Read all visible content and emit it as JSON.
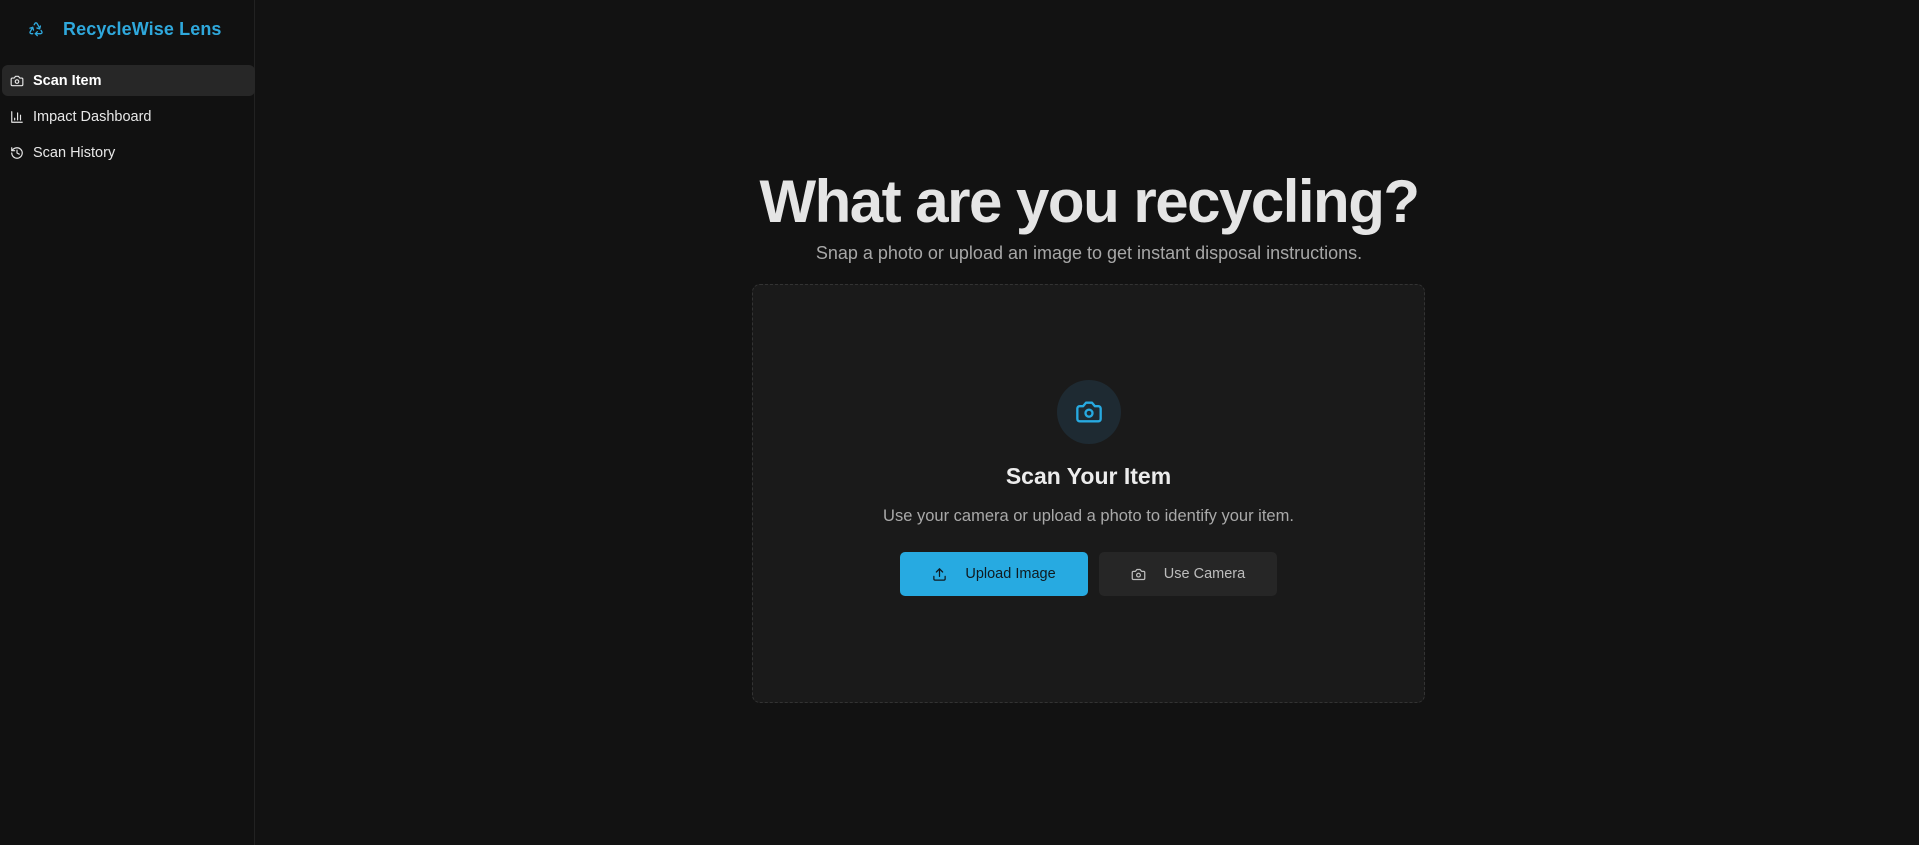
{
  "app": {
    "name": "RecycleWise Lens"
  },
  "sidebar": {
    "items": [
      {
        "label": "Scan Item",
        "icon": "camera-icon",
        "active": true
      },
      {
        "label": "Impact Dashboard",
        "icon": "bar-chart-icon",
        "active": false
      },
      {
        "label": "Scan History",
        "icon": "history-icon",
        "active": false
      }
    ]
  },
  "main": {
    "title": "What are you recycling?",
    "subtitle": "Snap a photo or upload an image to get instant disposal instructions.",
    "card": {
      "icon": "camera-icon",
      "title": "Scan Your Item",
      "text": "Use your camera or upload a photo to identify your item.",
      "upload_label": "Upload Image",
      "upload_icon": "upload-icon",
      "camera_label": "Use Camera",
      "camera_icon": "camera-icon"
    }
  },
  "colors": {
    "accent": "#27aae1",
    "background": "#121212",
    "card": "#1a1a1a"
  }
}
